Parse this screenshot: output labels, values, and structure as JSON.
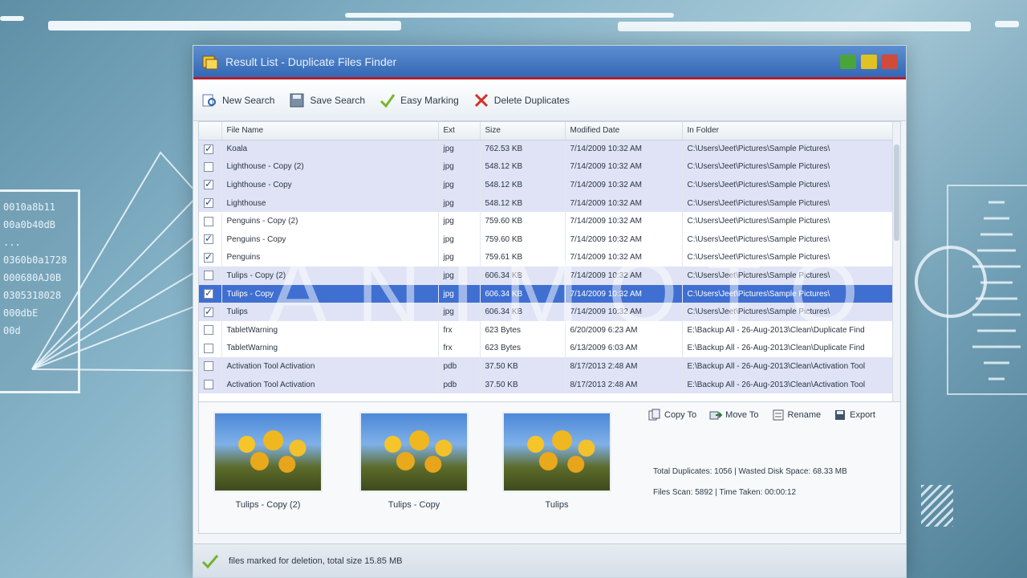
{
  "window": {
    "title": "Result List - Duplicate Files Finder"
  },
  "toolbar": {
    "new_search": "New Search",
    "save_search": "Save Search",
    "easy_marking": "Easy Marking",
    "delete_duplicates": "Delete Duplicates"
  },
  "table": {
    "headers": {
      "name": "File Name",
      "ext": "Ext",
      "size": "Size",
      "modified": "Modified Date",
      "folder": "In Folder"
    },
    "rows": [
      {
        "checked": true,
        "name": "Koala",
        "ext": "jpg",
        "size": "762.53 KB",
        "modified": "7/14/2009 10:32 AM",
        "folder": "C:\\Users\\Jeet\\Pictures\\Sample Pictures\\"
      },
      {
        "checked": false,
        "name": "Lighthouse - Copy (2)",
        "ext": "jpg",
        "size": "548.12 KB",
        "modified": "7/14/2009 10:32 AM",
        "folder": "C:\\Users\\Jeet\\Pictures\\Sample Pictures\\"
      },
      {
        "checked": true,
        "name": "Lighthouse - Copy",
        "ext": "jpg",
        "size": "548.12 KB",
        "modified": "7/14/2009 10:32 AM",
        "folder": "C:\\Users\\Jeet\\Pictures\\Sample Pictures\\"
      },
      {
        "checked": true,
        "name": "Lighthouse",
        "ext": "jpg",
        "size": "548.12 KB",
        "modified": "7/14/2009 10:32 AM",
        "folder": "C:\\Users\\Jeet\\Pictures\\Sample Pictures\\"
      },
      {
        "checked": false,
        "name": "Penguins - Copy (2)",
        "ext": "jpg",
        "size": "759.60 KB",
        "modified": "7/14/2009 10:32 AM",
        "folder": "C:\\Users\\Jeet\\Pictures\\Sample Pictures\\"
      },
      {
        "checked": true,
        "name": "Penguins - Copy",
        "ext": "jpg",
        "size": "759.60 KB",
        "modified": "7/14/2009 10:32 AM",
        "folder": "C:\\Users\\Jeet\\Pictures\\Sample Pictures\\"
      },
      {
        "checked": true,
        "name": "Penguins",
        "ext": "jpg",
        "size": "759.61 KB",
        "modified": "7/14/2009 10:32 AM",
        "folder": "C:\\Users\\Jeet\\Pictures\\Sample Pictures\\"
      },
      {
        "checked": false,
        "name": "Tulips - Copy (2)",
        "ext": "jpg",
        "size": "606.34 KB",
        "modified": "7/14/2009 10:32 AM",
        "folder": "C:\\Users\\Jeet\\Pictures\\Sample Pictures\\"
      },
      {
        "checked": true,
        "name": "Tulips - Copy",
        "ext": "jpg",
        "size": "606.34 KB",
        "modified": "7/14/2009 10:32 AM",
        "folder": "C:\\Users\\Jeet\\Pictures\\Sample Pictures\\"
      },
      {
        "checked": true,
        "name": "Tulips",
        "ext": "jpg",
        "size": "606.34 KB",
        "modified": "7/14/2009 10:32 AM",
        "folder": "C:\\Users\\Jeet\\Pictures\\Sample Pictures\\"
      },
      {
        "checked": false,
        "name": "TabletWarning",
        "ext": "frx",
        "size": "623 Bytes",
        "modified": "6/20/2009 6:23 AM",
        "folder": "E:\\Backup All - 26-Aug-2013\\Clean\\Duplicate Find"
      },
      {
        "checked": false,
        "name": "TabletWarning",
        "ext": "frx",
        "size": "623 Bytes",
        "modified": "6/13/2009 6:03 AM",
        "folder": "E:\\Backup All - 26-Aug-2013\\Clean\\Duplicate Find"
      },
      {
        "checked": false,
        "name": "Activation Tool Activation",
        "ext": "pdb",
        "size": "37.50 KB",
        "modified": "8/17/2013 2:48 AM",
        "folder": "E:\\Backup All - 26-Aug-2013\\Clean\\Activation Tool"
      },
      {
        "checked": false,
        "name": "Activation Tool Activation",
        "ext": "pdb",
        "size": "37.50 KB",
        "modified": "8/17/2013 2:48 AM",
        "folder": "E:\\Backup All - 26-Aug-2013\\Clean\\Activation Tool"
      }
    ]
  },
  "preview": {
    "thumbs": [
      {
        "label": "Tulips - Copy (2)"
      },
      {
        "label": "Tulips - Copy"
      },
      {
        "label": "Tulips"
      }
    ],
    "actions": {
      "copy_to": "Copy To",
      "move_to": "Move To",
      "rename": "Rename",
      "export": "Export"
    },
    "stats": {
      "line1": "Total Duplicates: 1056 | Wasted Disk Space: 68.33 MB",
      "line2": "Files Scan: 5892 | Time Taken: 00:00:12"
    }
  },
  "statusbar": {
    "text": "files marked for deletion, total size 15.85 MB"
  },
  "overlay": {
    "watermark": "ANIMOTO",
    "hud_lines": [
      "0010a8b11",
      "00a0b40dB",
      "...",
      "0360b0a1728",
      "",
      "000680AJ0B",
      "0305318028",
      "",
      "000dbE",
      "00d"
    ]
  },
  "colors": {
    "title_bar": "#3568b5",
    "selected_row": "#3f6fd1",
    "group_row": "#dfe3f5",
    "accent_red": "#b1202c"
  }
}
